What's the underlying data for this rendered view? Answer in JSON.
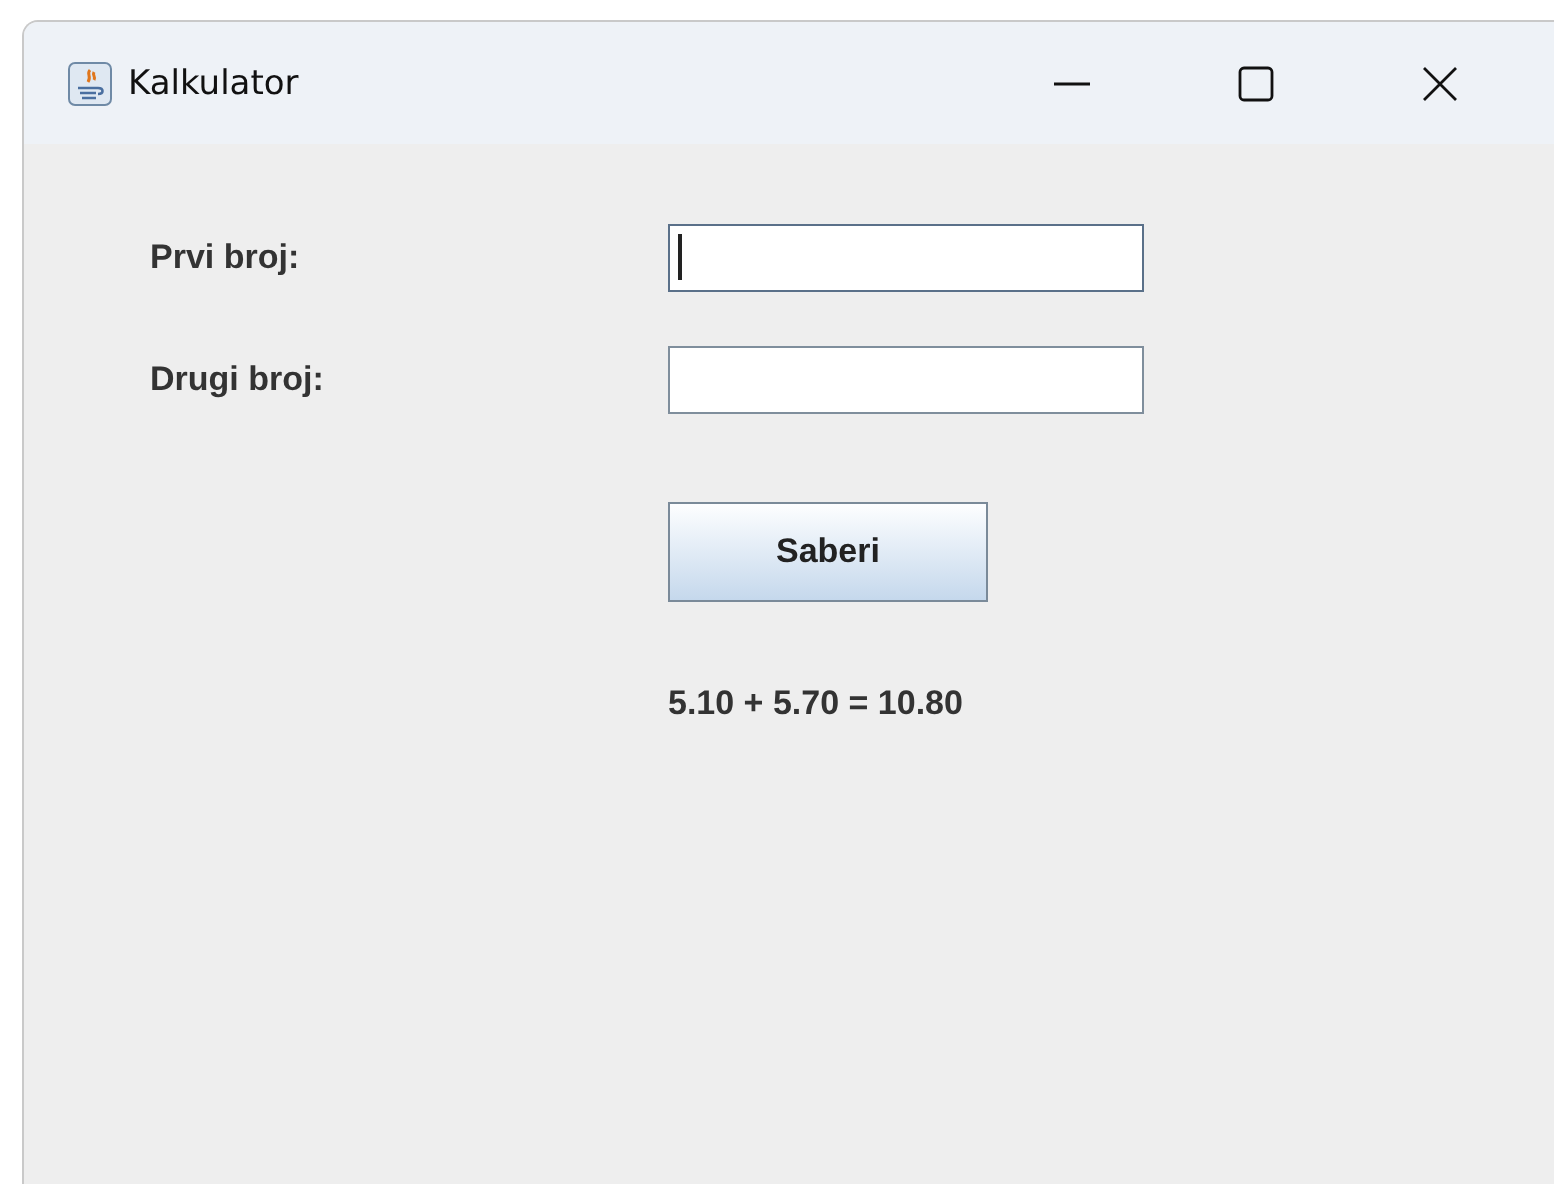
{
  "window": {
    "title": "Kalkulator"
  },
  "fields": [
    {
      "label": "Prvi broj:",
      "focused": true
    },
    {
      "label": "Drugi broj:",
      "focused": false
    }
  ],
  "button": {
    "label": "Saberi"
  },
  "result": "5.10 + 5.70 = 10.80"
}
